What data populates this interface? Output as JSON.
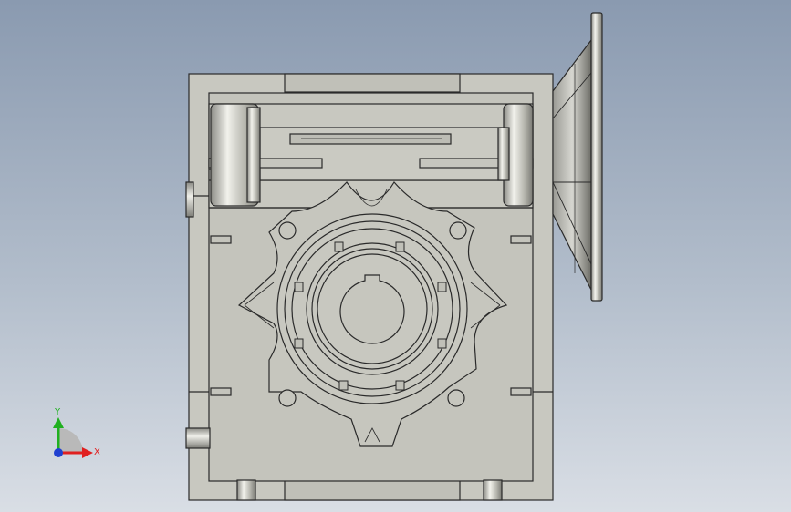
{
  "triad": {
    "x_label": "X",
    "y_label": "Y",
    "x_color": "#e02020",
    "y_color": "#20b020",
    "z_color": "#2040d0"
  },
  "colors": {
    "body_fill": "#c8c8c0",
    "edge": "#2a2a2a",
    "background_top": "#8a9ab0",
    "background_bottom": "#d9dee5"
  }
}
